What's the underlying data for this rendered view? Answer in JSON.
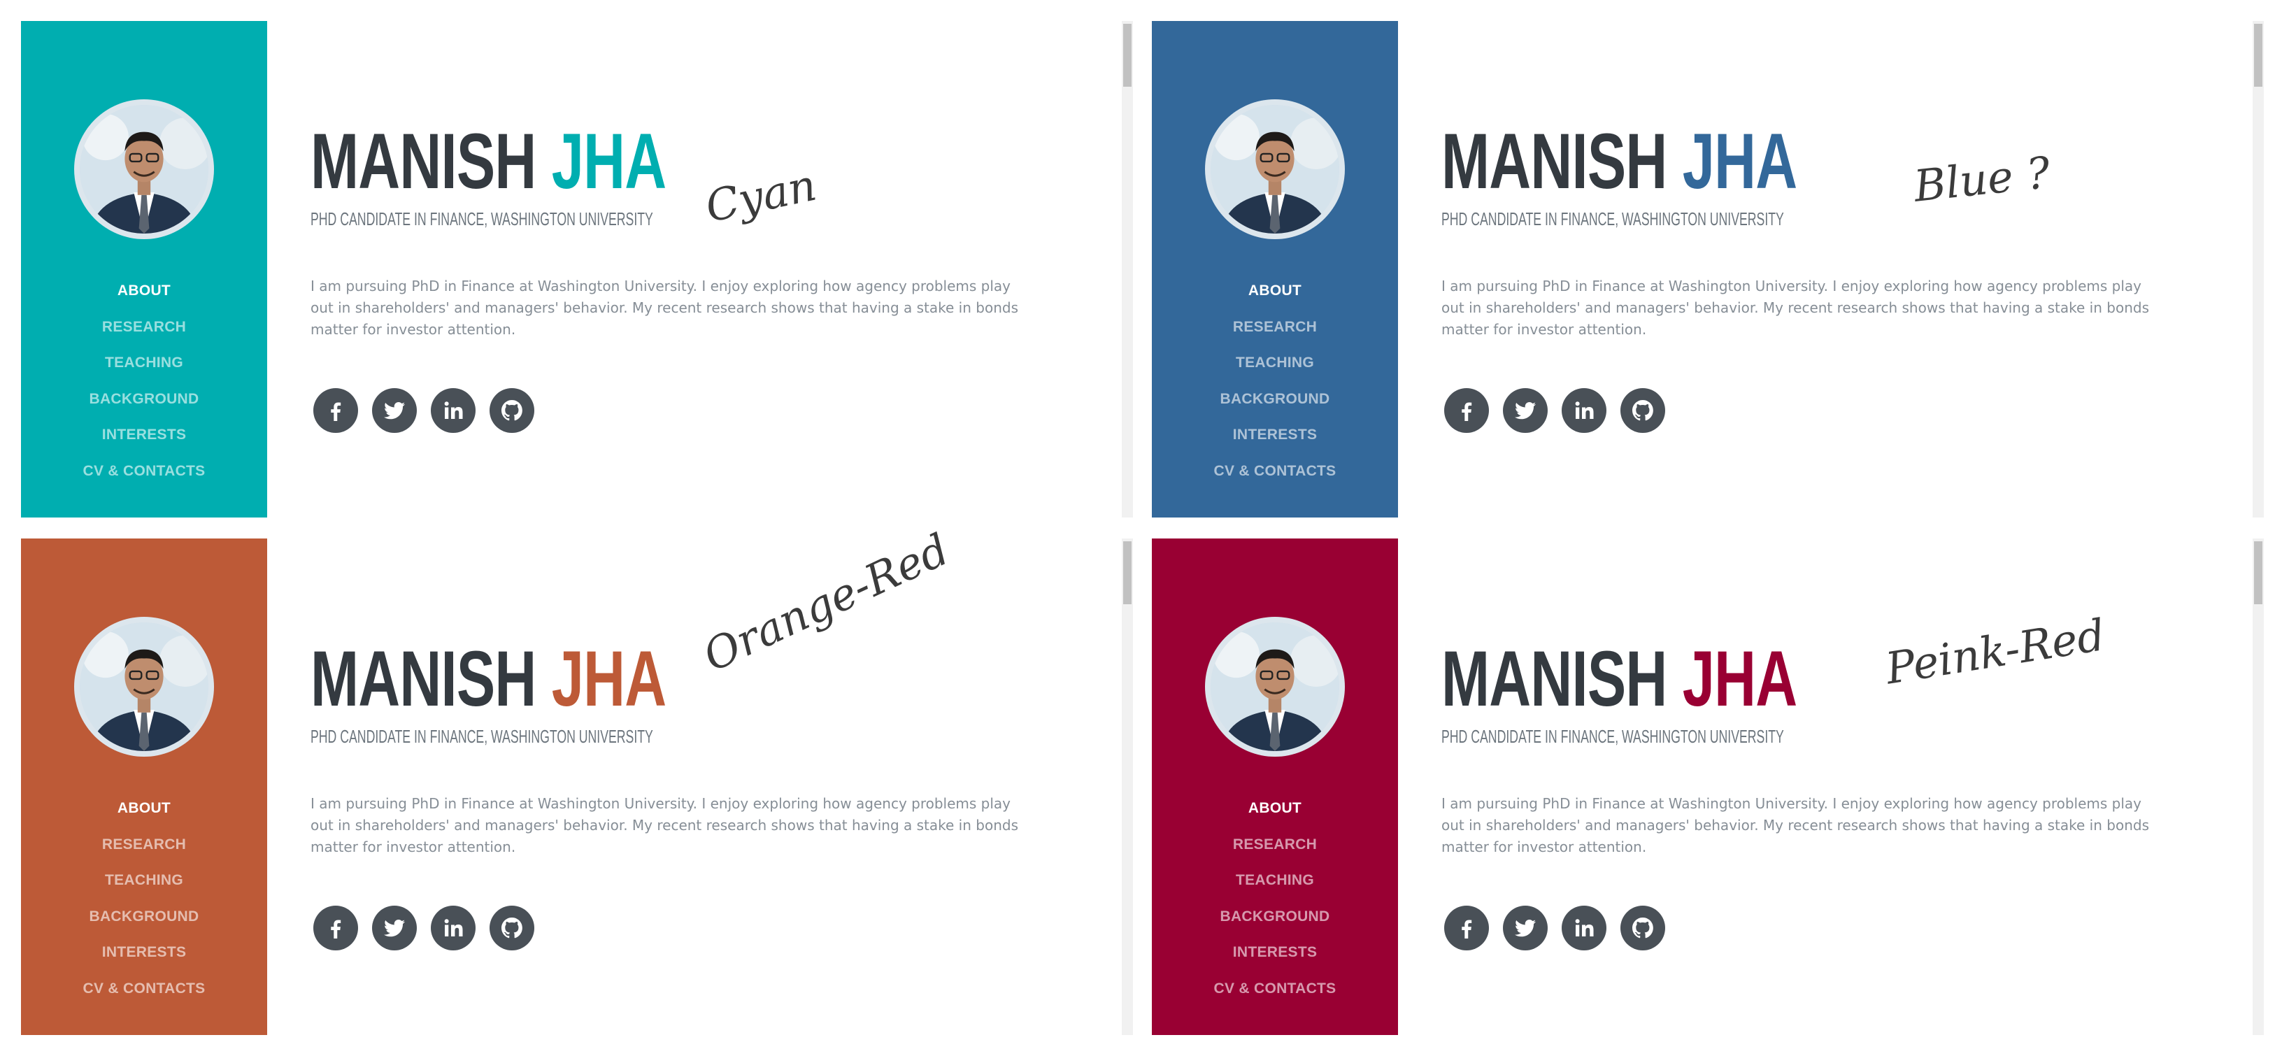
{
  "theme_colors": [
    "#00AEB0",
    "#33689A",
    "#BD5A37",
    "#990033"
  ],
  "panels": [
    {
      "annotation": "Cyan",
      "name_first": "MANISH",
      "name_last": "JHA",
      "subheading": "PHD CANDIDATE IN FINANCE, WASHINGTON UNIVERSITY",
      "lead": "I am pursuing PhD in Finance at Washington University. I enjoy exploring how agency problems play out in shareholders' and managers' behavior. My recent research shows that having a stake in bonds matter for investor attention.",
      "nav": [
        "ABOUT",
        "RESEARCH",
        "TEACHING",
        "BACKGROUND",
        "INTERESTS",
        "CV & CONTACTS"
      ],
      "social_icons": [
        "facebook-icon",
        "twitter-icon",
        "linkedin-icon",
        "github-icon"
      ]
    },
    {
      "annotation": "Blue ?",
      "name_first": "MANISH",
      "name_last": "JHA",
      "subheading": "PHD CANDIDATE IN FINANCE, WASHINGTON UNIVERSITY",
      "lead": "I am pursuing PhD in Finance at Washington University. I enjoy exploring how agency problems play out in shareholders' and managers' behavior. My recent research shows that having a stake in bonds matter for investor attention.",
      "nav": [
        "ABOUT",
        "RESEARCH",
        "TEACHING",
        "BACKGROUND",
        "INTERESTS",
        "CV & CONTACTS"
      ],
      "social_icons": [
        "facebook-icon",
        "twitter-icon",
        "linkedin-icon",
        "github-icon"
      ]
    },
    {
      "annotation": "Orange-Red",
      "name_first": "MANISH",
      "name_last": "JHA",
      "subheading": "PHD CANDIDATE IN FINANCE, WASHINGTON UNIVERSITY",
      "lead": "I am pursuing PhD in Finance at Washington University. I enjoy exploring how agency problems play out in shareholders' and managers' behavior. My recent research shows that having a stake in bonds matter for investor attention.",
      "nav": [
        "ABOUT",
        "RESEARCH",
        "TEACHING",
        "BACKGROUND",
        "INTERESTS",
        "CV & CONTACTS"
      ],
      "social_icons": [
        "facebook-icon",
        "twitter-icon",
        "linkedin-icon",
        "github-icon"
      ]
    },
    {
      "annotation": "Peink-Red",
      "name_first": "MANISH",
      "name_last": "JHA",
      "subheading": "PHD CANDIDATE IN FINANCE, WASHINGTON UNIVERSITY",
      "lead": "I am pursuing PhD in Finance at Washington University. I enjoy exploring how agency problems play out in shareholders' and managers' behavior. My recent research shows that having a stake in bonds matter for investor attention.",
      "nav": [
        "ABOUT",
        "RESEARCH",
        "TEACHING",
        "BACKGROUND",
        "INTERESTS",
        "CV & CONTACTS"
      ],
      "social_icons": [
        "facebook-icon",
        "twitter-icon",
        "linkedin-icon",
        "github-icon"
      ]
    }
  ]
}
